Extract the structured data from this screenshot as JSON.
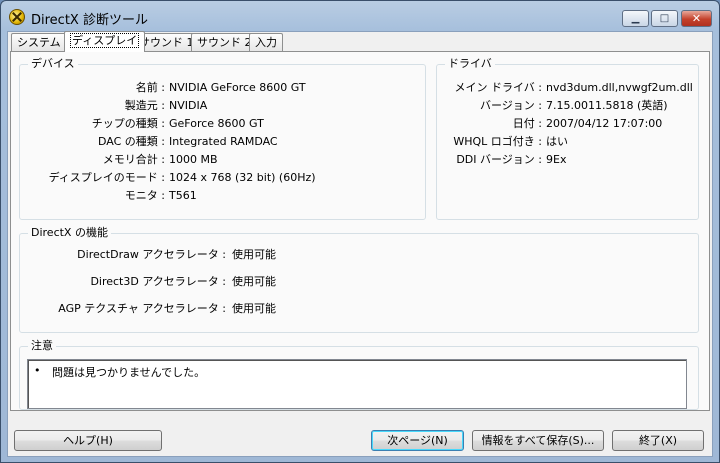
{
  "window": {
    "title": "DirectX 診断ツール"
  },
  "titlebar_buttons": {
    "minimize": "▁",
    "maximize": "□",
    "close": "✕"
  },
  "tabs": [
    {
      "label": "システム"
    },
    {
      "label": "ディスプレイ",
      "active": true
    },
    {
      "label": "サウンド 1"
    },
    {
      "label": "サウンド 2"
    },
    {
      "label": "入力"
    }
  ],
  "device": {
    "title": "デバイス",
    "rows": [
      {
        "label": "名前 :",
        "value": "NVIDIA GeForce 8600 GT"
      },
      {
        "label": "製造元 :",
        "value": "NVIDIA"
      },
      {
        "label": "チップの種類 :",
        "value": "GeForce 8600 GT"
      },
      {
        "label": "DAC の種類 :",
        "value": "Integrated RAMDAC"
      },
      {
        "label": "メモリ合計 :",
        "value": "1000 MB"
      },
      {
        "label": "ディスプレイのモード :",
        "value": "1024 x 768 (32 bit) (60Hz)"
      },
      {
        "label": "モニタ :",
        "value": "T561"
      }
    ]
  },
  "driver": {
    "title": "ドライバ",
    "rows": [
      {
        "label": "メイン ドライバ :",
        "value": "nvd3dum.dll,nvwgf2um.dll"
      },
      {
        "label": "バージョン :",
        "value": "7.15.0011.5818 (英語)"
      },
      {
        "label": "日付 :",
        "value": "2007/04/12 17:07:00"
      },
      {
        "label": "WHQL ロゴ付き :",
        "value": "はい"
      },
      {
        "label": "DDI バージョン :",
        "value": "9Ex"
      }
    ]
  },
  "features": {
    "title": "DirectX の機能",
    "rows": [
      {
        "label": "DirectDraw アクセラレータ :",
        "value": "使用可能"
      },
      {
        "label": "Direct3D アクセラレータ :",
        "value": "使用可能"
      },
      {
        "label": "AGP テクスチャ アクセラレータ :",
        "value": "使用可能"
      }
    ]
  },
  "notes": {
    "title": "注意",
    "bullet": "•",
    "text": "問題は見つかりませんでした。"
  },
  "buttons": {
    "help": "ヘルプ(H)",
    "next": "次ページ(N)",
    "save": "情報をすべて保存(S)...",
    "exit": "終了(X)"
  }
}
